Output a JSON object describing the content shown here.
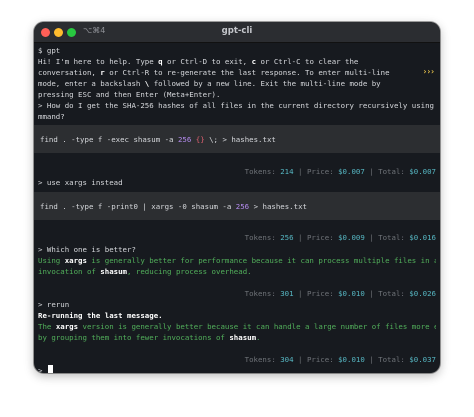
{
  "window": {
    "shortcut": "⌥⌘4",
    "title": "gpt-cli"
  },
  "prompt_line": {
    "dollar": "$",
    "command": "gpt"
  },
  "chevrons": "›››",
  "intro": [
    [
      "Hi! I'm here to help. Type ",
      "q",
      " or Ctrl-D to exit, ",
      "c",
      " or Ctrl-C to clear the"
    ],
    [
      "conversation, ",
      "r",
      " or Ctrl-R to re-generate the last response. To enter multi-line"
    ],
    [
      "mode, enter a backslash ",
      "\\",
      " followed by a new line. Exit the multi-line mode by"
    ],
    [
      "pressing ESC and then Enter (Meta+Enter).",
      "",
      "",
      "",
      ""
    ]
  ],
  "conversation": {
    "q1_line1": "> How do I get the SHA-256 hashes of all files in the current directory recursively using a shell co",
    "q1_line2": "mmand?",
    "code1": {
      "pre": "find . -type f -exec shasum -a ",
      "num": "256",
      "mid": " ",
      "brace": "{}",
      "post": " \\; > hashes.txt"
    },
    "stats1": {
      "tokens_label": "Tokens: ",
      "tokens": "214",
      "price_label": " | Price: ",
      "price": "$0.007",
      "total_label": " | Total: ",
      "total": "$0.007"
    },
    "q2": "> use xargs instead",
    "code2": {
      "pre": "find . -type f -print0 | xargs -0 shasum -a ",
      "num": "256",
      "post": " > hashes.txt"
    },
    "stats2": {
      "tokens_label": "Tokens: ",
      "tokens": "256",
      "price_label": " | Price: ",
      "price": "$0.009",
      "total_label": " | Total: ",
      "total": "$0.016"
    },
    "q3": "> Which one is better?",
    "a3_line1": {
      "pre": "Using ",
      "kw": "xargs",
      "post": " is generally better for performance because it can process multiple files in a single"
    },
    "a3_line2": {
      "pre": "invocation of ",
      "kw": "shasum",
      "post": ", reducing process overhead."
    },
    "stats3": {
      "tokens_label": "Tokens: ",
      "tokens": "301",
      "price_label": " | Price: ",
      "price": "$0.010",
      "total_label": " | Total: ",
      "total": "$0.026"
    },
    "q4": "> rerun",
    "rerun_msg": "Re-running the last message.",
    "a4_line1": {
      "pre": "The ",
      "kw": "xargs",
      "post": " version is generally better because it can handle a large number of files more efficiently"
    },
    "a4_line2": {
      "pre": "by grouping them into fewer invocations of ",
      "kw": "shasum",
      "post": "."
    },
    "stats4": {
      "tokens_label": "Tokens: ",
      "tokens": "304",
      "price_label": " | Price: ",
      "price": "$0.010",
      "total_label": " | Total: ",
      "total": "$0.037"
    },
    "input_prompt": ">"
  }
}
